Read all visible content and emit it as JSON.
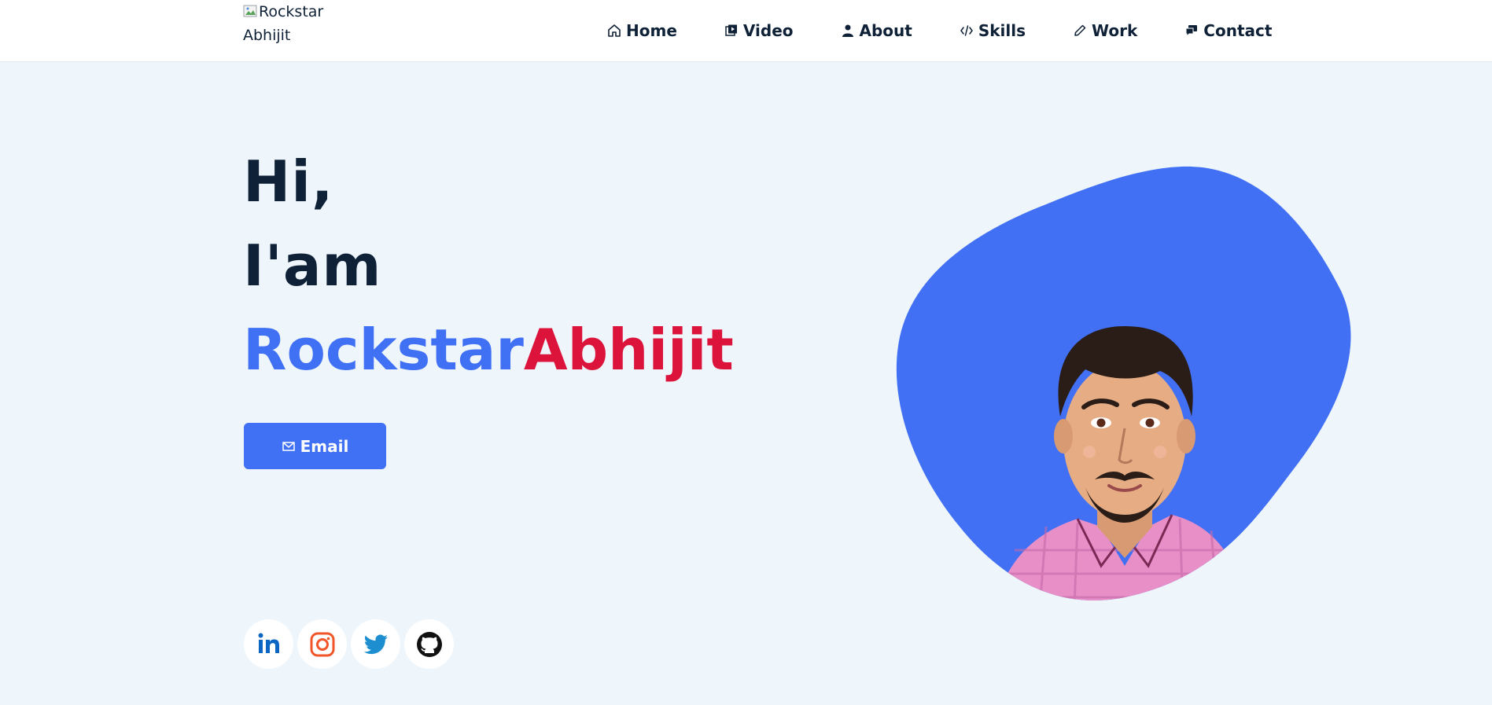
{
  "header": {
    "logo_alt_line1": "Rockstar",
    "logo_alt_line2": "Abhijit"
  },
  "nav": {
    "items": [
      {
        "label": "Home",
        "icon": "home-icon"
      },
      {
        "label": "Video",
        "icon": "video-icon"
      },
      {
        "label": "About",
        "icon": "user-icon"
      },
      {
        "label": "Skills",
        "icon": "code-icon"
      },
      {
        "label": "Work",
        "icon": "pencil-icon"
      },
      {
        "label": "Contact",
        "icon": "chat-icon"
      }
    ]
  },
  "hero": {
    "greeting_line1": "Hi,",
    "greeting_line2": "I'am",
    "name_first": "Rockstar",
    "name_last": "Abhijit",
    "email_button_label": "Email"
  },
  "socials": [
    {
      "name": "linkedin",
      "icon": "linkedin-icon"
    },
    {
      "name": "instagram",
      "icon": "instagram-icon"
    },
    {
      "name": "twitter",
      "icon": "twitter-icon"
    },
    {
      "name": "github",
      "icon": "github-icon"
    }
  ],
  "colors": {
    "primary": "#4070f4",
    "accent": "#dc143c",
    "dark_text": "#0f2137",
    "background": "#eef6fc"
  }
}
